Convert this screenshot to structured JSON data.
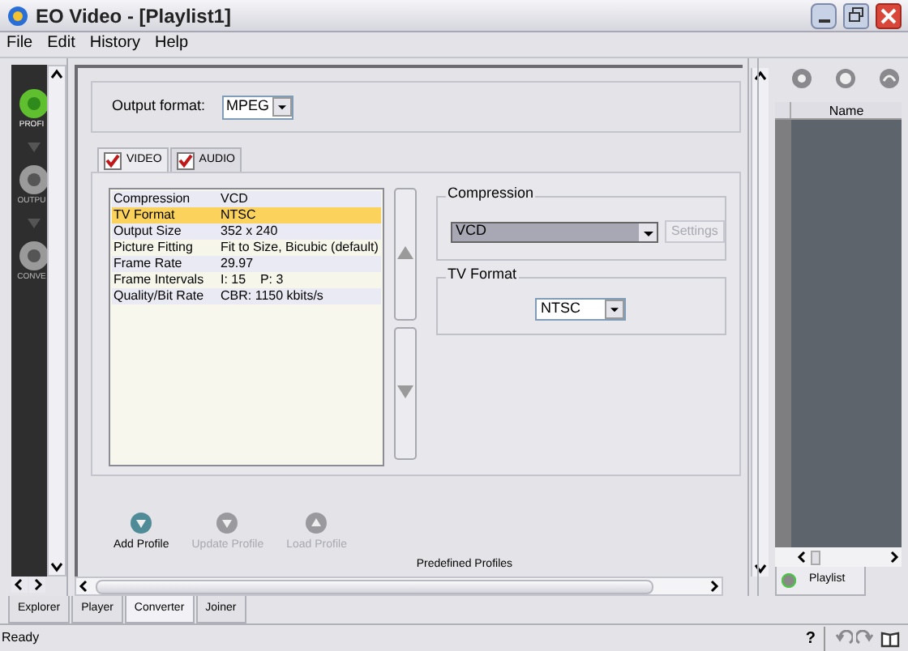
{
  "window": {
    "title": "EO Video - [Playlist1]"
  },
  "menu": [
    "File",
    "Edit",
    "History",
    "Help"
  ],
  "nav": [
    {
      "label": "PROFI",
      "selected": true
    },
    {
      "label": "OUTPU",
      "selected": false
    },
    {
      "label": "CONVE",
      "selected": false
    }
  ],
  "output_format": {
    "label": "Output format:",
    "value": "MPEG"
  },
  "tabs": [
    {
      "label": "VIDEO",
      "checked": true,
      "selected": true
    },
    {
      "label": "AUDIO",
      "checked": true,
      "selected": false
    }
  ],
  "properties": [
    {
      "name": "Compression",
      "value": "VCD",
      "selected": false
    },
    {
      "name": "TV Format",
      "value": "NTSC",
      "selected": true
    },
    {
      "name": "Output Size",
      "value": "352 x 240",
      "selected": false
    },
    {
      "name": "Picture Fitting",
      "value": "Fit to Size, Bicubic (default)",
      "selected": false
    },
    {
      "name": "Frame Rate",
      "value": "29.97",
      "selected": false
    },
    {
      "name": "Frame Intervals",
      "value": "I: 15    P: 3",
      "selected": false
    },
    {
      "name": "Quality/Bit Rate",
      "value": "CBR: 1150 kbits/s",
      "selected": false
    }
  ],
  "compression": {
    "title": "Compression",
    "value": "VCD",
    "settings": {
      "label": "Settings",
      "disabled": true
    }
  },
  "tv_format": {
    "title": "TV Format",
    "value": "NTSC"
  },
  "profile_buttons": [
    {
      "label": "Add Profile",
      "disabled": false,
      "kind": "down"
    },
    {
      "label": "Update Profile",
      "disabled": true,
      "kind": "down"
    },
    {
      "label": "Load Profile",
      "disabled": true,
      "kind": "up"
    }
  ],
  "predefined_profiles": "Predefined Profiles",
  "playlist": {
    "column": "Name",
    "tab": "Playlist"
  },
  "bottom_tabs": [
    {
      "label": "Explorer",
      "selected": false
    },
    {
      "label": "Player",
      "selected": false
    },
    {
      "label": "Converter",
      "selected": true
    },
    {
      "label": "Joiner",
      "selected": false
    }
  ],
  "status_bar": {
    "text": "Ready",
    "help": "?"
  }
}
